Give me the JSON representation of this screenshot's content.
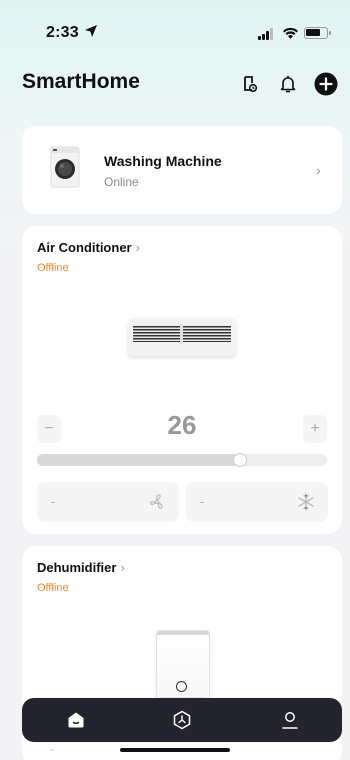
{
  "status_bar": {
    "time": "2:33"
  },
  "header": {
    "title": "SmartHome"
  },
  "devices": {
    "washing_machine": {
      "name": "Washing Machine",
      "status": "Online"
    },
    "air_conditioner": {
      "name": "Air Conditioner",
      "status": "Offline",
      "temperature": "26",
      "minus": "−",
      "plus": "+",
      "slider_fraction": 0.71,
      "fan_value": "-",
      "mode_value": "-"
    },
    "dehumidifier": {
      "name": "Dehumidifier",
      "status": "Offline",
      "left_value": "-",
      "right_value": "-"
    }
  },
  "chevron": "›",
  "colors": {
    "offline": "#f08a24",
    "tab_bar": "#23242d",
    "accent": "#111111"
  },
  "icons": [
    "location-arrow-icon",
    "cellular-signal-icon",
    "wifi-icon",
    "battery-icon",
    "device-scan-icon",
    "bell-icon",
    "plus-circle-icon",
    "fan-icon",
    "snowflake-icon",
    "home-icon",
    "automation-icon",
    "profile-icon"
  ]
}
